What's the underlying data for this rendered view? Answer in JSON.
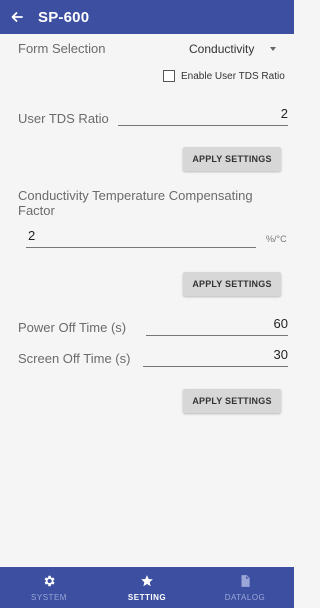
{
  "appbar": {
    "title": "SP-600"
  },
  "form": {
    "form_selection_label": "Form Selection",
    "form_selection_value": "Conductivity",
    "enable_tds_label": "Enable User TDS Ratio",
    "user_tds_ratio_label": "User TDS Ratio",
    "user_tds_ratio_value": "2",
    "apply_settings_1": "APPLY SETTINGS",
    "ctc_factor_label": "Conductivity Temperature Compensating Factor",
    "ctc_factor_value": "2",
    "ctc_factor_unit": "%/°C",
    "apply_settings_2": "APPLY SETTINGS",
    "power_off_label": "Power Off Time (s)",
    "power_off_value": "60",
    "screen_off_label": "Screen Off Time (s)",
    "screen_off_value": "30",
    "apply_settings_3": "APPLY SETTINGS"
  },
  "bottom_nav": {
    "items": [
      {
        "label": "SYSTEM",
        "icon": "gear-icon"
      },
      {
        "label": "SETTING",
        "icon": "star-icon"
      },
      {
        "label": "DATALOG",
        "icon": "datalog-icon"
      }
    ]
  }
}
